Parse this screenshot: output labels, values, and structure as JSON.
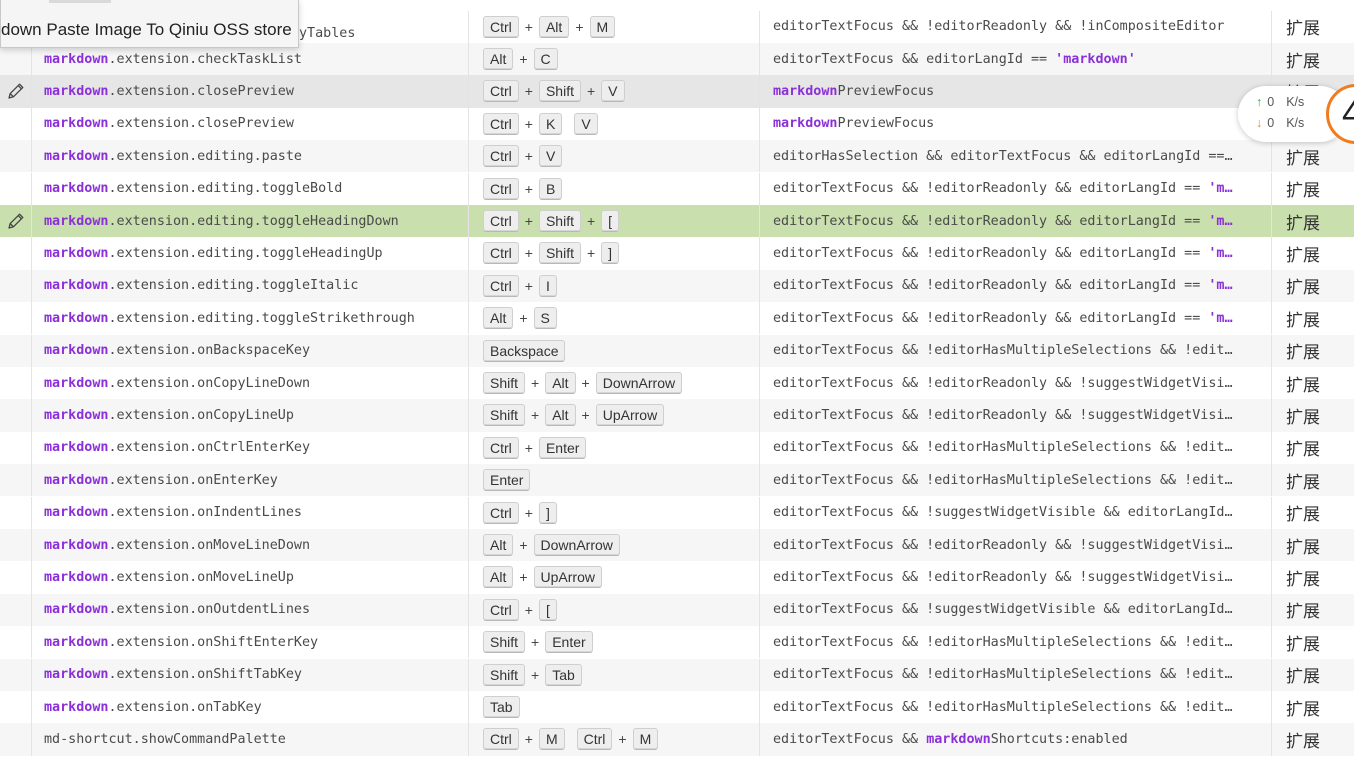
{
  "tooltip": {
    "text": "down Paste Image To Qiniu OSS store"
  },
  "partial_top_command": "yTables",
  "net_speed": {
    "up_value": "0",
    "up_unit": "K/s",
    "down_value": "0",
    "down_unit": "K/s",
    "badge": "4"
  },
  "colors": {
    "selected_row": "#c9dfad",
    "hovered_row": "#e6e6e6",
    "namespace": "#8b30d8",
    "upload_arrow": "#3aa64c",
    "download_arrow": "#ef8a2c"
  },
  "rows": [
    {
      "cmd_ns": "",
      "cmd_rest": "",
      "keys": [
        [
          "Ctrl",
          "Alt",
          "M"
        ]
      ],
      "when": [
        [
          "t",
          "editorTextFocus && !editorReadonly && !inCompositeEditor"
        ]
      ],
      "source": "扩展",
      "edit_icon": false,
      "state": ""
    },
    {
      "cmd_ns": "markdown",
      "cmd_rest": ".extension.checkTaskList",
      "keys": [
        [
          "Alt",
          "C"
        ]
      ],
      "when": [
        [
          "t",
          "editorTextFocus && editorLangId == "
        ],
        [
          "s",
          "'markdown'"
        ]
      ],
      "source": "扩展",
      "edit_icon": false,
      "state": "odd"
    },
    {
      "cmd_ns": "markdown",
      "cmd_rest": ".extension.closePreview",
      "keys": [
        [
          "Ctrl",
          "Shift",
          "V"
        ]
      ],
      "when": [
        [
          "n",
          "markdown"
        ],
        [
          "t",
          "PreviewFocus"
        ]
      ],
      "source": "扩展",
      "edit_icon": true,
      "state": "hovered"
    },
    {
      "cmd_ns": "markdown",
      "cmd_rest": ".extension.closePreview",
      "keys": [
        [
          "Ctrl",
          "K"
        ],
        [
          "V"
        ]
      ],
      "when": [
        [
          "n",
          "markdown"
        ],
        [
          "t",
          "PreviewFocus"
        ]
      ],
      "source": "扩展",
      "edit_icon": false,
      "state": ""
    },
    {
      "cmd_ns": "markdown",
      "cmd_rest": ".extension.editing.paste",
      "keys": [
        [
          "Ctrl",
          "V"
        ]
      ],
      "when": [
        [
          "t",
          "editorHasSelection && editorTextFocus && editorLangId ==…"
        ]
      ],
      "source": "扩展",
      "edit_icon": false,
      "state": "odd"
    },
    {
      "cmd_ns": "markdown",
      "cmd_rest": ".extension.editing.toggleBold",
      "keys": [
        [
          "Ctrl",
          "B"
        ]
      ],
      "when": [
        [
          "t",
          "editorTextFocus && !editorReadonly && editorLangId == "
        ],
        [
          "s",
          "'m…"
        ]
      ],
      "source": "扩展",
      "edit_icon": false,
      "state": ""
    },
    {
      "cmd_ns": "markdown",
      "cmd_rest": ".extension.editing.toggleHeadingDown",
      "keys": [
        [
          "Ctrl",
          "Shift",
          "["
        ]
      ],
      "when": [
        [
          "t",
          "editorTextFocus && !editorReadonly && editorLangId == "
        ],
        [
          "s",
          "'m…"
        ]
      ],
      "source": "扩展",
      "edit_icon": true,
      "state": "selected"
    },
    {
      "cmd_ns": "markdown",
      "cmd_rest": ".extension.editing.toggleHeadingUp",
      "keys": [
        [
          "Ctrl",
          "Shift",
          "]"
        ]
      ],
      "when": [
        [
          "t",
          "editorTextFocus && !editorReadonly && editorLangId == "
        ],
        [
          "s",
          "'m…"
        ]
      ],
      "source": "扩展",
      "edit_icon": false,
      "state": ""
    },
    {
      "cmd_ns": "markdown",
      "cmd_rest": ".extension.editing.toggleItalic",
      "keys": [
        [
          "Ctrl",
          "I"
        ]
      ],
      "when": [
        [
          "t",
          "editorTextFocus && !editorReadonly && editorLangId == "
        ],
        [
          "s",
          "'m…"
        ]
      ],
      "source": "扩展",
      "edit_icon": false,
      "state": "odd"
    },
    {
      "cmd_ns": "markdown",
      "cmd_rest": ".extension.editing.toggleStrikethrough",
      "keys": [
        [
          "Alt",
          "S"
        ]
      ],
      "when": [
        [
          "t",
          "editorTextFocus && !editorReadonly && editorLangId == "
        ],
        [
          "s",
          "'m…"
        ]
      ],
      "source": "扩展",
      "edit_icon": false,
      "state": ""
    },
    {
      "cmd_ns": "markdown",
      "cmd_rest": ".extension.onBackspaceKey",
      "keys": [
        [
          "Backspace"
        ]
      ],
      "when": [
        [
          "t",
          "editorTextFocus && !editorHasMultipleSelections && !edit…"
        ]
      ],
      "source": "扩展",
      "edit_icon": false,
      "state": "odd"
    },
    {
      "cmd_ns": "markdown",
      "cmd_rest": ".extension.onCopyLineDown",
      "keys": [
        [
          "Shift",
          "Alt",
          "DownArrow"
        ]
      ],
      "when": [
        [
          "t",
          "editorTextFocus && !editorReadonly && !suggestWidgetVisi…"
        ]
      ],
      "source": "扩展",
      "edit_icon": false,
      "state": ""
    },
    {
      "cmd_ns": "markdown",
      "cmd_rest": ".extension.onCopyLineUp",
      "keys": [
        [
          "Shift",
          "Alt",
          "UpArrow"
        ]
      ],
      "when": [
        [
          "t",
          "editorTextFocus && !editorReadonly && !suggestWidgetVisi…"
        ]
      ],
      "source": "扩展",
      "edit_icon": false,
      "state": "odd"
    },
    {
      "cmd_ns": "markdown",
      "cmd_rest": ".extension.onCtrlEnterKey",
      "keys": [
        [
          "Ctrl",
          "Enter"
        ]
      ],
      "when": [
        [
          "t",
          "editorTextFocus && !editorHasMultipleSelections && !edit…"
        ]
      ],
      "source": "扩展",
      "edit_icon": false,
      "state": ""
    },
    {
      "cmd_ns": "markdown",
      "cmd_rest": ".extension.onEnterKey",
      "keys": [
        [
          "Enter"
        ]
      ],
      "when": [
        [
          "t",
          "editorTextFocus && !editorHasMultipleSelections && !edit…"
        ]
      ],
      "source": "扩展",
      "edit_icon": false,
      "state": "odd"
    },
    {
      "cmd_ns": "markdown",
      "cmd_rest": ".extension.onIndentLines",
      "keys": [
        [
          "Ctrl",
          "]"
        ]
      ],
      "when": [
        [
          "t",
          "editorTextFocus && !suggestWidgetVisible && editorLangId…"
        ]
      ],
      "source": "扩展",
      "edit_icon": false,
      "state": ""
    },
    {
      "cmd_ns": "markdown",
      "cmd_rest": ".extension.onMoveLineDown",
      "keys": [
        [
          "Alt",
          "DownArrow"
        ]
      ],
      "when": [
        [
          "t",
          "editorTextFocus && !editorReadonly && !suggestWidgetVisi…"
        ]
      ],
      "source": "扩展",
      "edit_icon": false,
      "state": "odd"
    },
    {
      "cmd_ns": "markdown",
      "cmd_rest": ".extension.onMoveLineUp",
      "keys": [
        [
          "Alt",
          "UpArrow"
        ]
      ],
      "when": [
        [
          "t",
          "editorTextFocus && !editorReadonly && !suggestWidgetVisi…"
        ]
      ],
      "source": "扩展",
      "edit_icon": false,
      "state": ""
    },
    {
      "cmd_ns": "markdown",
      "cmd_rest": ".extension.onOutdentLines",
      "keys": [
        [
          "Ctrl",
          "["
        ]
      ],
      "when": [
        [
          "t",
          "editorTextFocus && !suggestWidgetVisible && editorLangId…"
        ]
      ],
      "source": "扩展",
      "edit_icon": false,
      "state": "odd"
    },
    {
      "cmd_ns": "markdown",
      "cmd_rest": ".extension.onShiftEnterKey",
      "keys": [
        [
          "Shift",
          "Enter"
        ]
      ],
      "when": [
        [
          "t",
          "editorTextFocus && !editorHasMultipleSelections && !edit…"
        ]
      ],
      "source": "扩展",
      "edit_icon": false,
      "state": ""
    },
    {
      "cmd_ns": "markdown",
      "cmd_rest": ".extension.onShiftTabKey",
      "keys": [
        [
          "Shift",
          "Tab"
        ]
      ],
      "when": [
        [
          "t",
          "editorTextFocus && !editorHasMultipleSelections && !edit…"
        ]
      ],
      "source": "扩展",
      "edit_icon": false,
      "state": "odd"
    },
    {
      "cmd_ns": "markdown",
      "cmd_rest": ".extension.onTabKey",
      "keys": [
        [
          "Tab"
        ]
      ],
      "when": [
        [
          "t",
          "editorTextFocus && !editorHasMultipleSelections && !edit…"
        ]
      ],
      "source": "扩展",
      "edit_icon": false,
      "state": ""
    },
    {
      "cmd_ns": "",
      "cmd_rest": "md-shortcut.showCommandPalette",
      "keys": [
        [
          "Ctrl",
          "M"
        ],
        [
          "Ctrl",
          "M"
        ]
      ],
      "when": [
        [
          "t",
          "editorTextFocus && "
        ],
        [
          "n",
          "markdown"
        ],
        [
          "t",
          "Shortcuts:enabled"
        ]
      ],
      "source": "扩展",
      "edit_icon": false,
      "state": "odd"
    }
  ]
}
